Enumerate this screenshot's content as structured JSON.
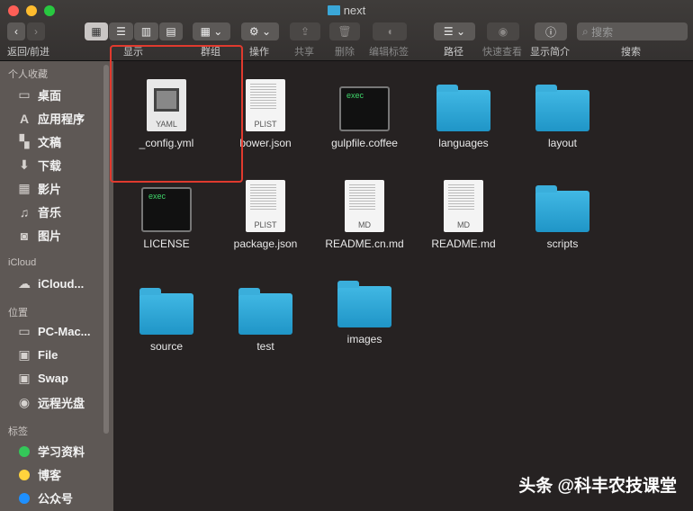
{
  "window": {
    "title": "next"
  },
  "toolbar": {
    "back_forward": "返回/前进",
    "view": "显示",
    "group": "群组",
    "action": "操作",
    "share": "共享",
    "delete": "删除",
    "edit_tags": "编辑标签",
    "path": "路径",
    "quick_look": "快速查看",
    "get_info": "显示简介",
    "search_label": "搜索",
    "search_placeholder": "搜索"
  },
  "sidebar": {
    "favorites_header": "个人收藏",
    "favorites": [
      {
        "label": "桌面",
        "icon": "desktop-icon"
      },
      {
        "label": "应用程序",
        "icon": "applications-icon"
      },
      {
        "label": "文稿",
        "icon": "documents-icon"
      },
      {
        "label": "下载",
        "icon": "downloads-icon"
      },
      {
        "label": "影片",
        "icon": "movies-icon"
      },
      {
        "label": "音乐",
        "icon": "music-icon"
      },
      {
        "label": "图片",
        "icon": "pictures-icon"
      }
    ],
    "icloud_header": "iCloud",
    "icloud": [
      {
        "label": "iCloud...",
        "icon": "cloud-icon"
      }
    ],
    "locations_header": "位置",
    "locations": [
      {
        "label": "PC-Mac...",
        "icon": "laptop-icon"
      },
      {
        "label": "File",
        "icon": "disk-icon"
      },
      {
        "label": "Swap",
        "icon": "disk-icon"
      },
      {
        "label": "远程光盘",
        "icon": "optical-disc-icon"
      }
    ],
    "tags_header": "标签",
    "tags": [
      {
        "label": "学习资料",
        "color": "#34c759"
      },
      {
        "label": "博客",
        "color": "#ffd33d"
      },
      {
        "label": "公众号",
        "color": "#1e90ff"
      }
    ]
  },
  "files": [
    {
      "name": "_config.yml",
      "type": "yaml",
      "badge": "YAML"
    },
    {
      "name": "bower.json",
      "type": "plist",
      "badge": "PLIST"
    },
    {
      "name": "gulpfile.coffee",
      "type": "exec",
      "badge": "exec"
    },
    {
      "name": "languages",
      "type": "folder"
    },
    {
      "name": "layout",
      "type": "folder"
    },
    {
      "name": "LICENSE",
      "type": "exec",
      "badge": "exec"
    },
    {
      "name": "package.json",
      "type": "plist",
      "badge": "PLIST"
    },
    {
      "name": "README.cn.md",
      "type": "md",
      "badge": "MD"
    },
    {
      "name": "README.md",
      "type": "md",
      "badge": "MD"
    },
    {
      "name": "scripts",
      "type": "folder"
    },
    {
      "name": "source",
      "type": "folder"
    },
    {
      "name": "test",
      "type": "folder"
    },
    {
      "name": "images",
      "type": "folder"
    }
  ],
  "watermark": "头条 @科丰农技课堂"
}
